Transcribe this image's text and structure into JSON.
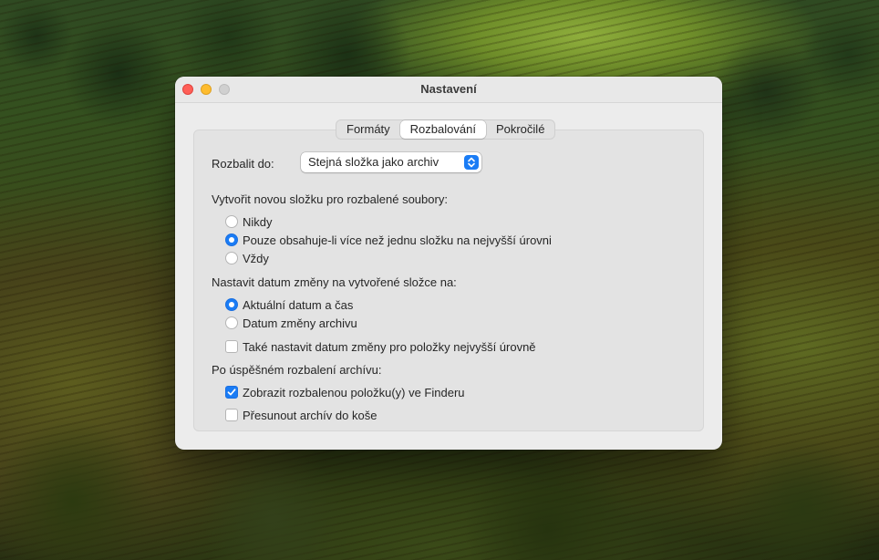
{
  "window": {
    "title": "Nastavení"
  },
  "tabs": [
    {
      "label": "Formáty",
      "active": false
    },
    {
      "label": "Rozbalování",
      "active": true
    },
    {
      "label": "Pokročilé",
      "active": false
    }
  ],
  "extract_to": {
    "label": "Rozbalit do:",
    "value": "Stejná složka jako archiv"
  },
  "new_folder": {
    "heading": "Vytvořit novou složku pro rozbalené soubory:",
    "options": [
      {
        "label": "Nikdy",
        "checked": false
      },
      {
        "label": "Pouze obsahuje-li více než jednu složku na nejvyšší úrovni",
        "checked": true
      },
      {
        "label": "Vždy",
        "checked": false
      }
    ]
  },
  "modified_date": {
    "heading": "Nastavit datum změny na vytvořené složce na:",
    "options": [
      {
        "label": "Aktuální datum a čas",
        "checked": true
      },
      {
        "label": "Datum změny archivu",
        "checked": false
      }
    ],
    "also_top_level": {
      "label": "Také nastavit datum změny pro položky nejvyšší úrovně",
      "checked": false
    }
  },
  "after_extract": {
    "heading": "Po úspěšném rozbalení archívu:",
    "options": [
      {
        "label": "Zobrazit rozbalenou položku(y) ve Finderu",
        "checked": true
      },
      {
        "label": "Přesunout archív do koše",
        "checked": false
      }
    ]
  },
  "colors": {
    "accent": "#1a7cf5",
    "close": "#ff5f57",
    "minimize": "#febc2e",
    "zoom_disabled": "#d0d0d0"
  }
}
